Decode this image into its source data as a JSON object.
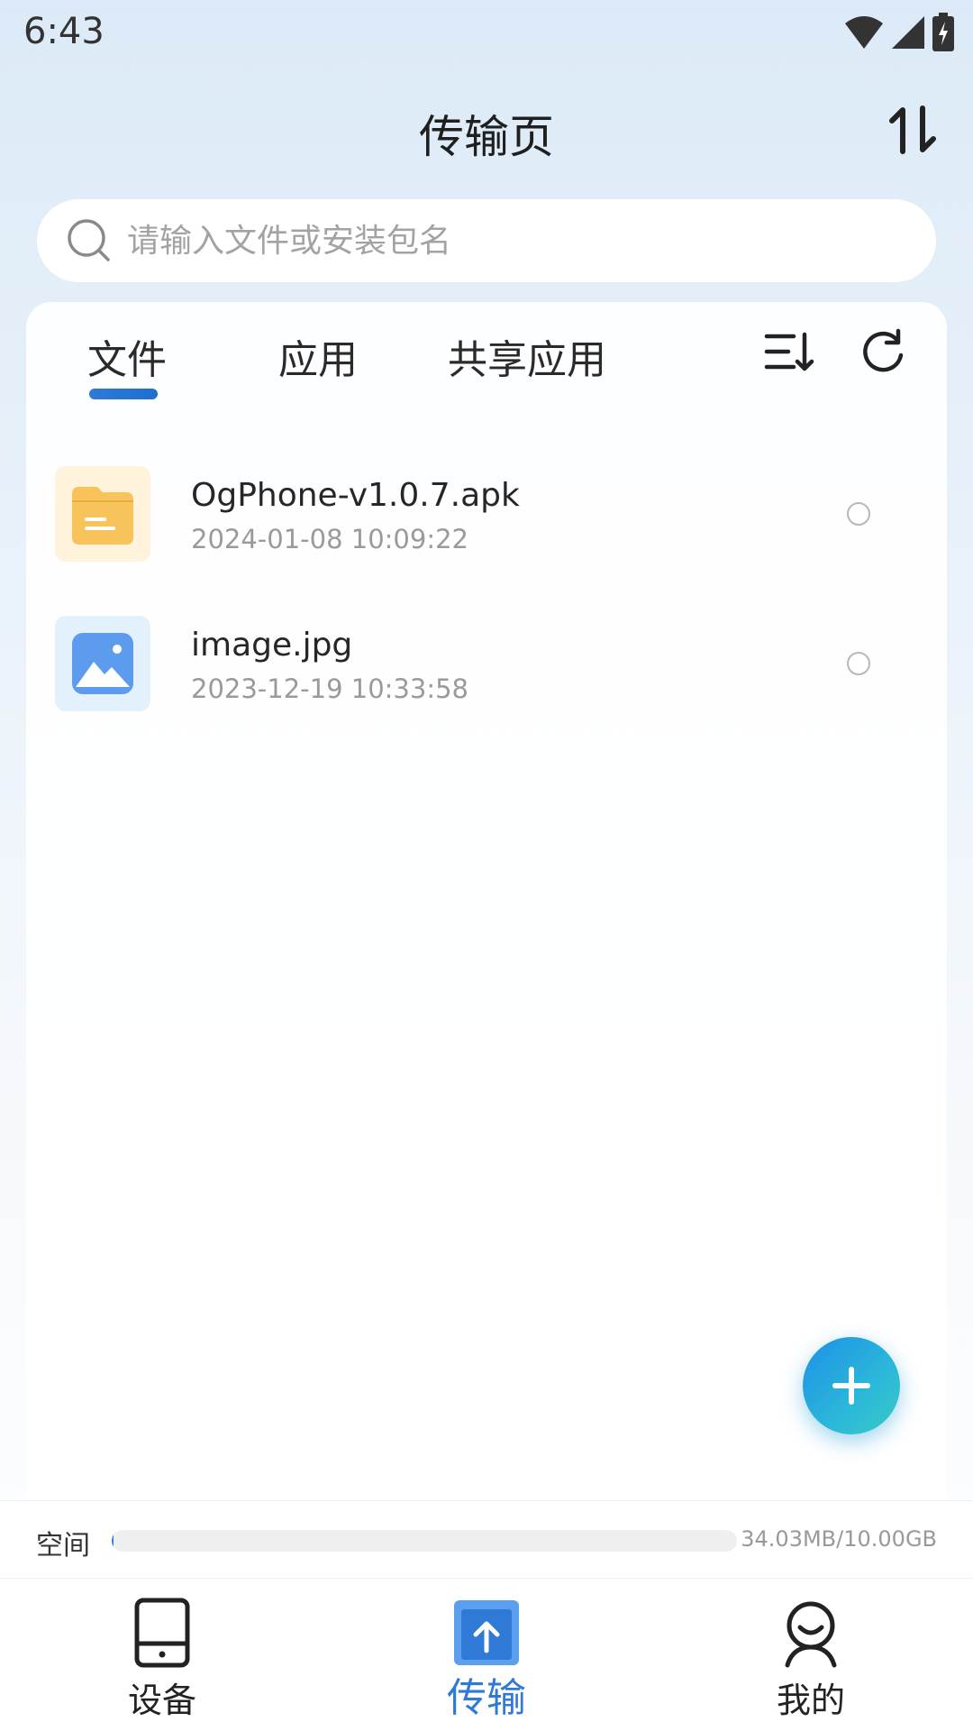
{
  "status_bar": {
    "time": "6:43",
    "icons": [
      "wifi-icon",
      "signal-icon",
      "battery-charging-icon"
    ]
  },
  "header": {
    "title": "传输页",
    "transfer_toggle_icon": "swap-vertical-icon"
  },
  "search": {
    "placeholder": "请输入文件或安装包名",
    "icon": "search-icon"
  },
  "tabs": [
    {
      "label": "文件",
      "active": true
    },
    {
      "label": "应用",
      "active": false
    },
    {
      "label": "共享应用",
      "active": false
    }
  ],
  "toolbar": {
    "sort_icon": "sort-icon",
    "refresh_icon": "refresh-icon"
  },
  "files": [
    {
      "name": "OgPhone-v1.0.7.apk",
      "date": "2024-01-08 10:09:22",
      "icon": "folder-icon",
      "selected": false
    },
    {
      "name": "image.jpg",
      "date": "2023-12-19 10:33:58",
      "icon": "image-icon",
      "selected": false
    }
  ],
  "fab": {
    "icon": "plus-icon"
  },
  "storage": {
    "label": "空间",
    "value": "34.03MB/10.00GB",
    "used_fraction": 0.0033
  },
  "bottom_nav": [
    {
      "label": "设备",
      "icon": "tablet-icon",
      "active": false
    },
    {
      "label": "传输",
      "icon": "upload-icon",
      "active": true
    },
    {
      "label": "我的",
      "icon": "profile-icon",
      "active": false
    }
  ],
  "colors": {
    "accent": "#2f7ad6",
    "fab_start": "#1e90e8",
    "fab_end": "#39c9c9",
    "apk_thumb_bg": "#fff3dc",
    "apk_icon": "#f7c35a",
    "image_thumb_bg": "#e2f1fb",
    "image_icon": "#5d9bef"
  }
}
